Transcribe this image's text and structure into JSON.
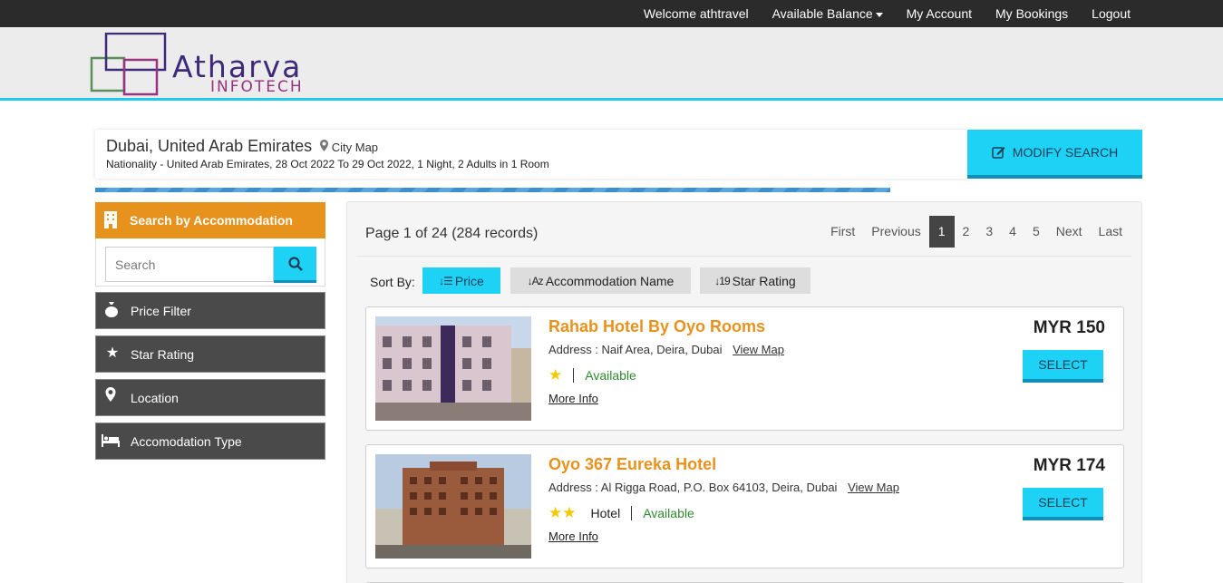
{
  "topbar": {
    "welcome": "Welcome athtravel",
    "balance": "Available Balance",
    "account": "My Account",
    "bookings": "My Bookings",
    "logout": "Logout"
  },
  "logo": {
    "title": "Atharva",
    "subtitle": "INFOTECH"
  },
  "search_summary": {
    "city": "Dubai, United Arab Emirates",
    "city_map": "City Map",
    "details": "Nationality - United Arab Emirates, 28 Oct 2022 To 29 Oct 2022, 1 Night, 2 Adults in 1 Room",
    "modify_label": "MODIFY SEARCH"
  },
  "sidebar": {
    "header": "Search by Accommodation",
    "search_placeholder": "Search",
    "filters": [
      {
        "label": "Price Filter",
        "icon": "money-bag-icon"
      },
      {
        "label": "Star Rating",
        "icon": "star-icon"
      },
      {
        "label": "Location",
        "icon": "map-pin-icon"
      },
      {
        "label": "Accomodation Type",
        "icon": "bed-icon"
      }
    ]
  },
  "results": {
    "page_info": "Page 1 of 24 (284 records)",
    "pagination": {
      "first": "First",
      "previous": "Previous",
      "pages": [
        "1",
        "2",
        "3",
        "4",
        "5"
      ],
      "current": "1",
      "next": "Next",
      "last": "Last"
    },
    "sort": {
      "label": "Sort By:",
      "options": [
        "Price",
        "Accommodation Name",
        "Star Rating"
      ],
      "active": "Price"
    },
    "hotels": [
      {
        "name": "Rahab Hotel By Oyo Rooms",
        "address": "Address : Naif Area, Deira, Dubai",
        "view_map": "View Map",
        "stars": 1,
        "type": "",
        "availability": "Available",
        "more_info": "More Info",
        "price": "MYR 150",
        "select": "SELECT"
      },
      {
        "name": "Oyo 367 Eureka Hotel",
        "address": "Address : Al Rigga Road, P.O. Box 64103, Deira, Dubai",
        "view_map": "View Map",
        "stars": 2,
        "type": "Hotel",
        "availability": "Available",
        "more_info": "More Info",
        "price": "MYR 174",
        "select": "SELECT"
      }
    ]
  },
  "colors": {
    "accent": "#1ed2f5",
    "orange": "#e8921e",
    "dark": "#2b2b2b",
    "available": "#2e8b2e"
  }
}
